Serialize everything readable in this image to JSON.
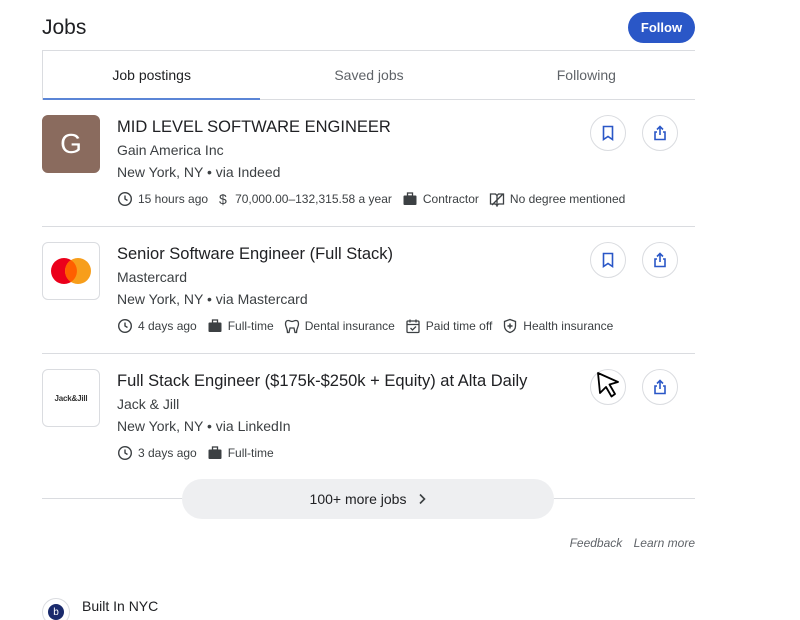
{
  "header": {
    "title": "Jobs",
    "follow_label": "Follow"
  },
  "tabs": [
    {
      "label": "Job postings",
      "active": true
    },
    {
      "label": "Saved jobs",
      "active": false
    },
    {
      "label": "Following",
      "active": false
    }
  ],
  "jobs": [
    {
      "logo_text": "G",
      "title": "MID LEVEL SOFTWARE ENGINEER",
      "company": "Gain America Inc",
      "location": "New York, NY • via Indeed",
      "meta": {
        "posted": "15 hours ago",
        "salary": "70,000.00–132,315.58 a year",
        "type": "Contractor",
        "degree": "No degree mentioned"
      }
    },
    {
      "logo_text": "",
      "title": "Senior Software Engineer (Full Stack)",
      "company": "Mastercard",
      "location": "New York, NY • via Mastercard",
      "meta": {
        "posted": "4 days ago",
        "type": "Full-time",
        "benefit1": "Dental insurance",
        "benefit2": "Paid time off",
        "benefit3": "Health insurance"
      }
    },
    {
      "logo_text": "Jack&Jill",
      "title": "Full Stack Engineer ($175k-$250k + Equity) at Alta Daily",
      "company": "Jack & Jill",
      "location": "New York, NY • via LinkedIn",
      "meta": {
        "posted": "3 days ago",
        "type": "Full-time"
      }
    }
  ],
  "more_jobs_label": "100+ more jobs",
  "footer": {
    "feedback": "Feedback",
    "learn_more": "Learn more"
  },
  "source": {
    "icon_letter": "b",
    "name": "Built In NYC"
  },
  "colors": {
    "accent": "#2a57c7",
    "mastercard_red": "#eb001b",
    "mastercard_orange": "#f79e1b",
    "gain_logo": "#8a6b5e"
  }
}
